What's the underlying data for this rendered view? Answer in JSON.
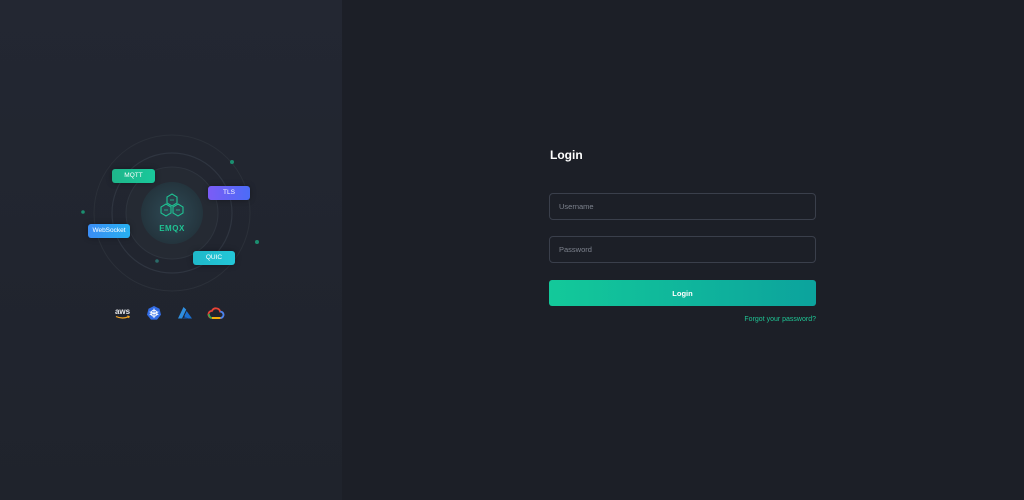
{
  "hero": {
    "product_name": "EMQX",
    "protocol_tags": {
      "mqtt": "MQTT",
      "tls": "TLS",
      "websocket": "WebSocket",
      "quic": "QUIC"
    },
    "cloud_providers": [
      "aws-logo",
      "kubernetes-logo",
      "azure-logo",
      "google-cloud-logo"
    ],
    "aws_text": "aws"
  },
  "login": {
    "title": "Login",
    "username_placeholder": "Username",
    "password_placeholder": "Password",
    "submit_label": "Login",
    "forgot_link": "Forgot your password?"
  },
  "colors": {
    "accent": "#1fc393",
    "background_left": "#232732",
    "background_right": "#1c1f27"
  }
}
